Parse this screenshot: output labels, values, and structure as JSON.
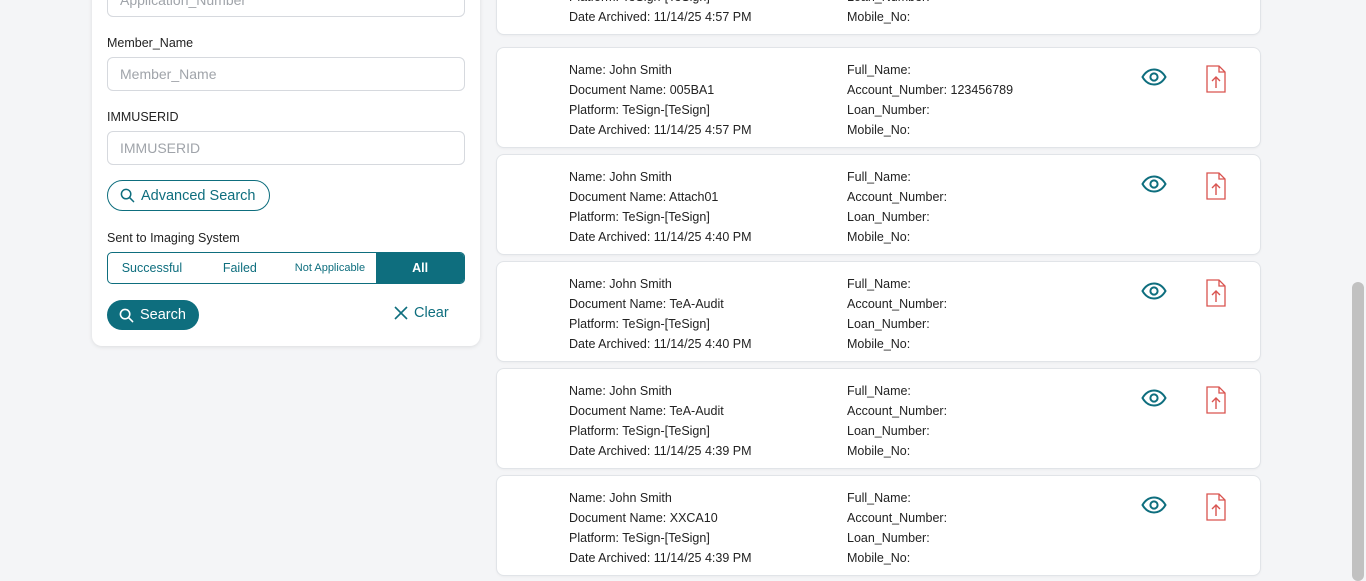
{
  "filters": {
    "app_number_placeholder": "Application_Number",
    "member_name_label": "Member_Name",
    "member_name_placeholder": "Member_Name",
    "immuserid_label": "IMMUSERID",
    "immuserid_placeholder": "IMMUSERID",
    "advanced_search_label": "Advanced Search",
    "sent_label": "Sent to Imaging System",
    "segments": [
      "Successful",
      "Failed",
      "Not Applicable",
      "All"
    ],
    "active_segment": "All",
    "search_label": "Search",
    "clear_label": "Clear"
  },
  "records": [
    {
      "name": "",
      "document": "",
      "platform": "Platform: TeSign-[TeSign]",
      "date": "Date Archived: 11/14/25 4:57 PM",
      "full_name": "",
      "account": "",
      "loan": "Loan_Number:",
      "mobile": "Mobile_No:"
    },
    {
      "name": "Name: John Smith",
      "document": "Document Name: 005BA1",
      "platform": "Platform: TeSign-[TeSign]",
      "date": "Date Archived: 11/14/25 4:57 PM",
      "full_name": "Full_Name:",
      "account": "Account_Number: 123456789",
      "loan": "Loan_Number:",
      "mobile": "Mobile_No:"
    },
    {
      "name": "Name: John Smith",
      "document": "Document Name: Attach01",
      "platform": "Platform: TeSign-[TeSign]",
      "date": "Date Archived: 11/14/25 4:40 PM",
      "full_name": "Full_Name:",
      "account": "Account_Number:",
      "loan": "Loan_Number:",
      "mobile": "Mobile_No:"
    },
    {
      "name": "Name: John Smith",
      "document": "Document Name: TeA-Audit",
      "platform": "Platform: TeSign-[TeSign]",
      "date": "Date Archived: 11/14/25 4:40 PM",
      "full_name": "Full_Name:",
      "account": "Account_Number:",
      "loan": "Loan_Number:",
      "mobile": "Mobile_No:"
    },
    {
      "name": "Name: John Smith",
      "document": "Document Name: TeA-Audit",
      "platform": "Platform: TeSign-[TeSign]",
      "date": "Date Archived: 11/14/25 4:39 PM",
      "full_name": "Full_Name:",
      "account": "Account_Number:",
      "loan": "Loan_Number:",
      "mobile": "Mobile_No:"
    },
    {
      "name": "Name: John Smith",
      "document": "Document Name: XXCA10",
      "platform": "Platform: TeSign-[TeSign]",
      "date": "Date Archived: 11/14/25 4:39 PM",
      "full_name": "Full_Name:",
      "account": "Account_Number:",
      "loan": "Loan_Number:",
      "mobile": "Mobile_No:"
    }
  ],
  "icons": {
    "view": "eye-icon",
    "pdf": "pdf-upload-icon",
    "search": "search-icon",
    "clear": "close-icon"
  },
  "colors": {
    "accent": "#0e6e7e",
    "pdf": "#d9534f"
  }
}
